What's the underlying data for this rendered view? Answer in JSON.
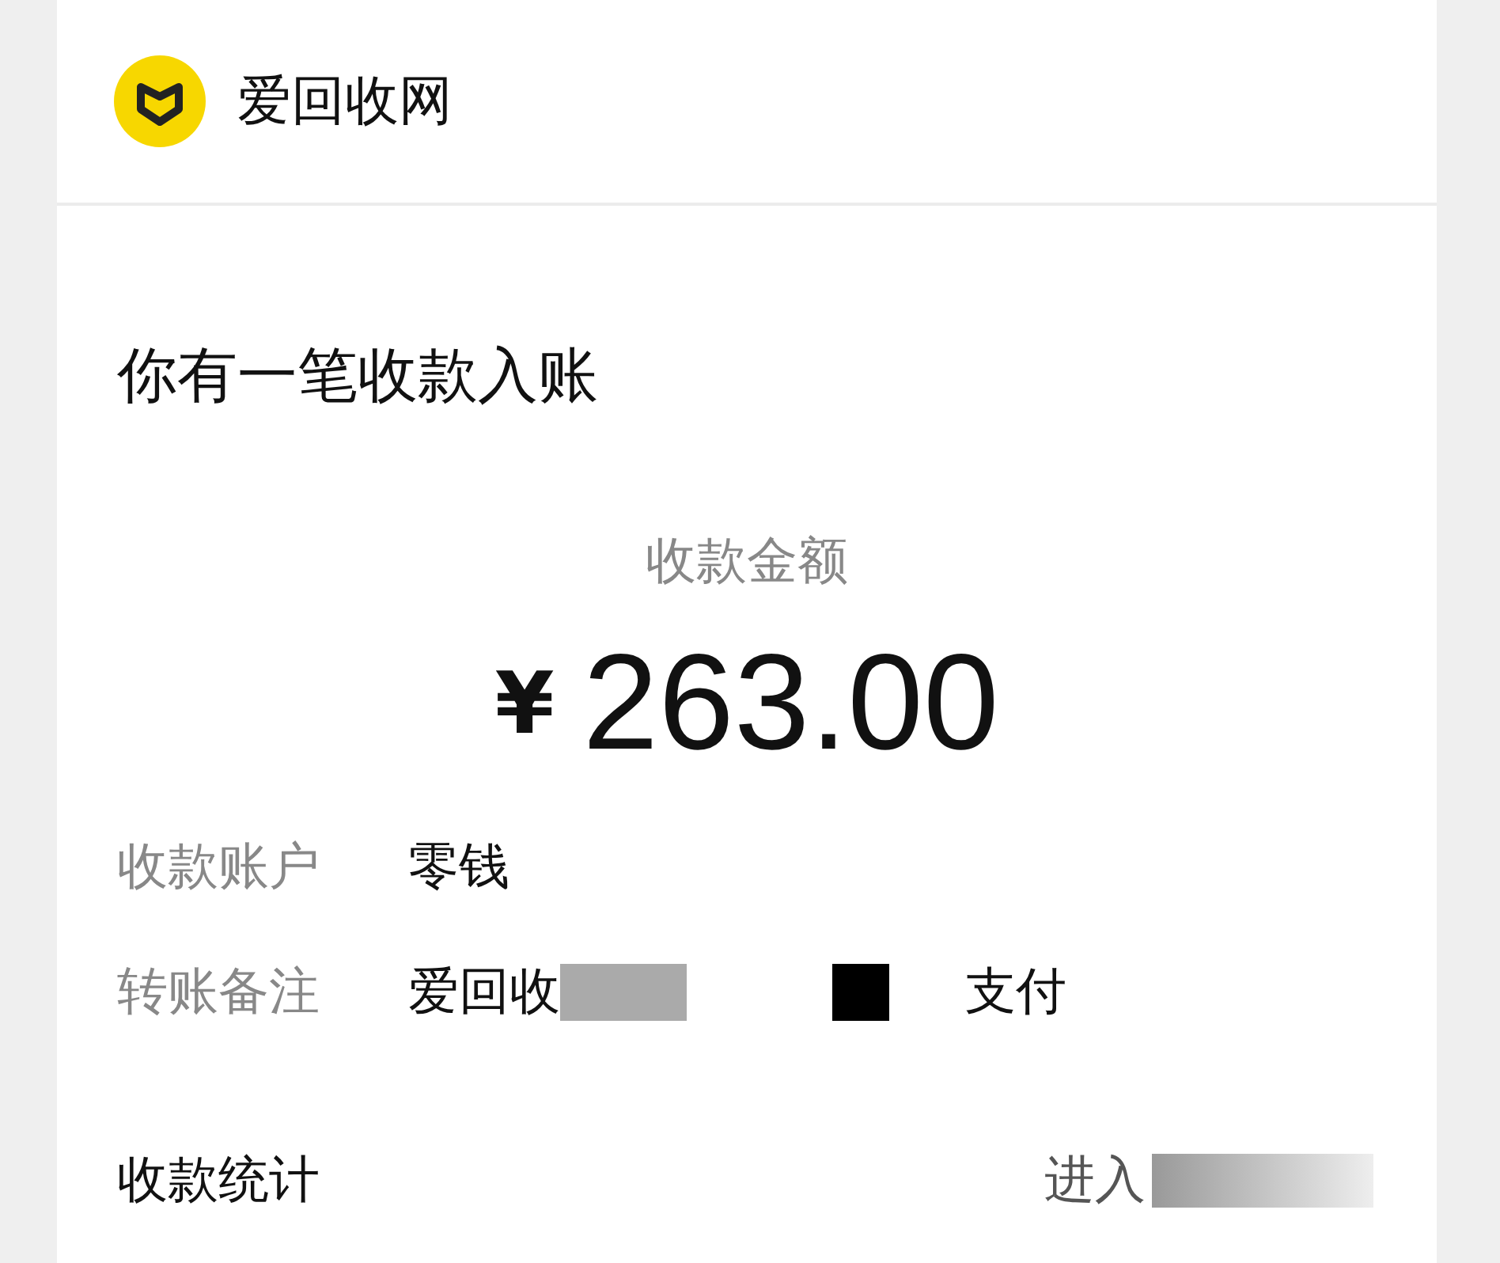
{
  "header": {
    "brand": "爱回收网"
  },
  "title": "你有一笔收款入账",
  "amount": {
    "label": "收款金额",
    "currency": "¥",
    "value": "263.00"
  },
  "details": [
    {
      "label": "收款账户",
      "value": "零钱"
    },
    {
      "label": "转账备注",
      "value": "爱回收",
      "tail": "支付"
    }
  ],
  "footer": {
    "label": "收款统计",
    "link": "进入"
  }
}
